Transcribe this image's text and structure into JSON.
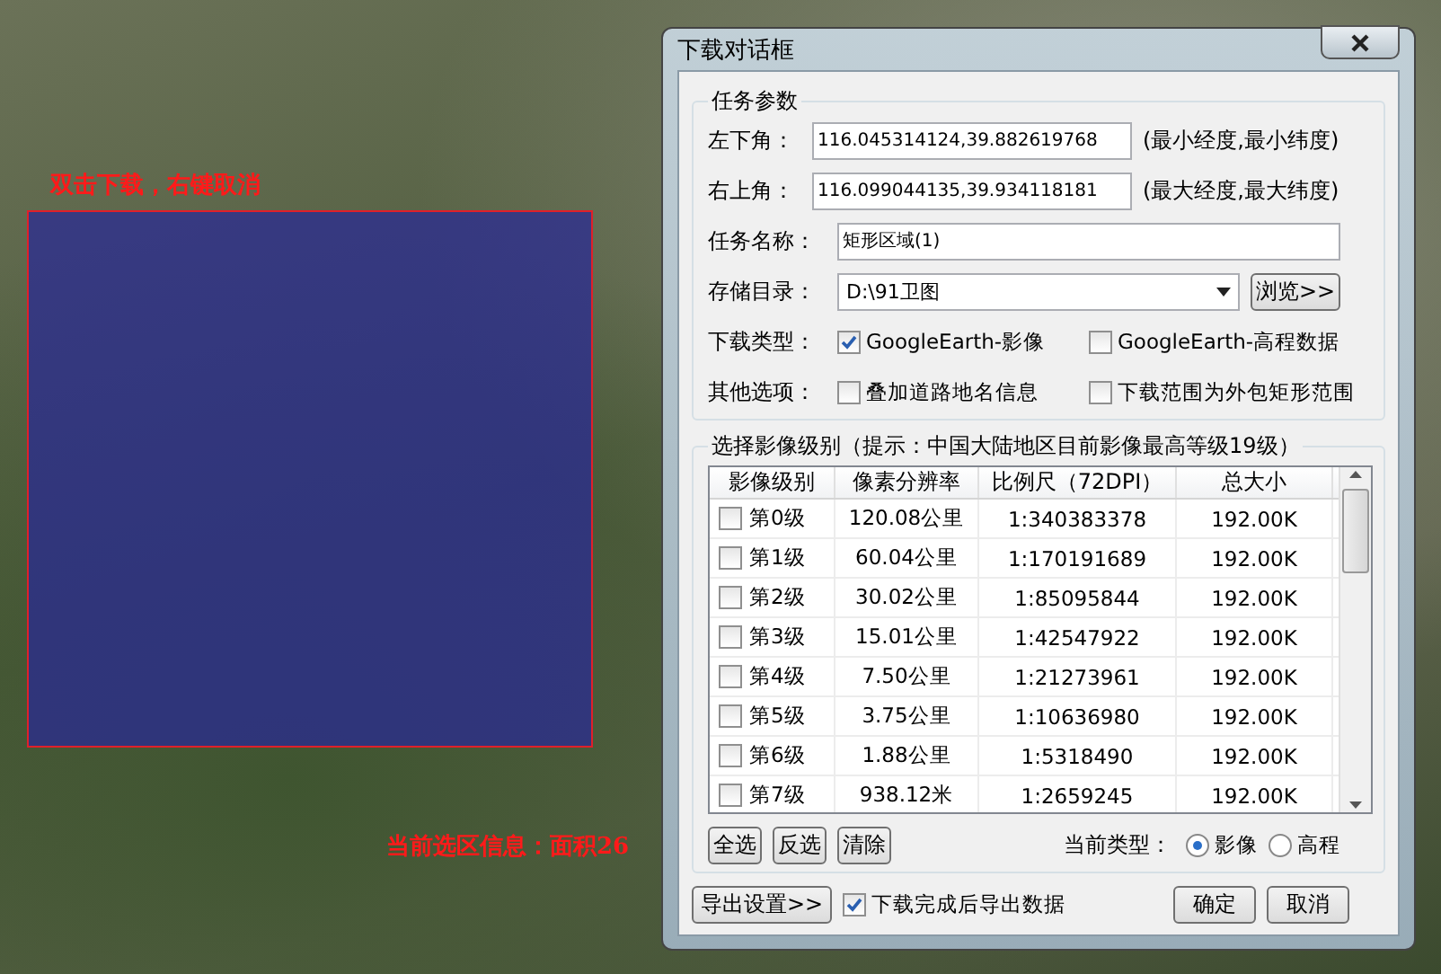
{
  "map": {
    "hint": "双击下载，右键取消",
    "selection_info": "当前选区信息：面积26"
  },
  "dialog": {
    "title": "下载对话框",
    "task_group": {
      "title": "任务参数",
      "bottom_left": {
        "label": "左下角：",
        "value": "116.045314124,39.882619768",
        "note": "(最小经度,最小纬度)"
      },
      "top_right": {
        "label": "右上角：",
        "value": "116.099044135,39.934118181",
        "note": "(最大经度,最大纬度)"
      },
      "task_name": {
        "label": "任务名称：",
        "value": "矩形区域(1)"
      },
      "directory": {
        "label": "存储目录：",
        "value": "D:\\91卫图",
        "browse": "浏览>>"
      },
      "download_type": {
        "label": "下载类型：",
        "options": [
          {
            "label": "GoogleEarth-影像",
            "checked": true
          },
          {
            "label": "GoogleEarth-高程数据",
            "checked": false
          }
        ]
      },
      "other_options": {
        "label": "其他选项：",
        "options": [
          {
            "label": "叠加道路地名信息",
            "checked": false
          },
          {
            "label": "下载范围为外包矩形范围",
            "checked": false
          }
        ]
      }
    },
    "level_group": {
      "title": "选择影像级别（提示：中国大陆地区目前影像最高等级19级）",
      "columns": [
        "影像级别",
        "像素分辨率",
        "比例尺（72DPI）",
        "总大小"
      ],
      "rows": [
        {
          "level": "第0级",
          "resolution": "120.08公里",
          "scale": "1:340383378",
          "size": "192.00K",
          "checked": false
        },
        {
          "level": "第1级",
          "resolution": "60.04公里",
          "scale": "1:170191689",
          "size": "192.00K",
          "checked": false
        },
        {
          "level": "第2级",
          "resolution": "30.02公里",
          "scale": "1:85095844",
          "size": "192.00K",
          "checked": false
        },
        {
          "level": "第3级",
          "resolution": "15.01公里",
          "scale": "1:42547922",
          "size": "192.00K",
          "checked": false
        },
        {
          "level": "第4级",
          "resolution": "7.50公里",
          "scale": "1:21273961",
          "size": "192.00K",
          "checked": false
        },
        {
          "level": "第5级",
          "resolution": "3.75公里",
          "scale": "1:10636980",
          "size": "192.00K",
          "checked": false
        },
        {
          "level": "第6级",
          "resolution": "1.88公里",
          "scale": "1:5318490",
          "size": "192.00K",
          "checked": false
        },
        {
          "level": "第7级",
          "resolution": "938.12米",
          "scale": "1:2659245",
          "size": "192.00K",
          "checked": false
        }
      ],
      "buttons": [
        "全选",
        "反选",
        "清除"
      ],
      "current_type": {
        "label": "当前类型：",
        "options": [
          {
            "label": "影像",
            "selected": true
          },
          {
            "label": "高程",
            "selected": false
          }
        ]
      }
    },
    "export_button": "导出设置>>",
    "export_after": {
      "label": "下载完成后导出数据",
      "checked": true
    },
    "buttons": [
      "确定",
      "取消"
    ]
  }
}
